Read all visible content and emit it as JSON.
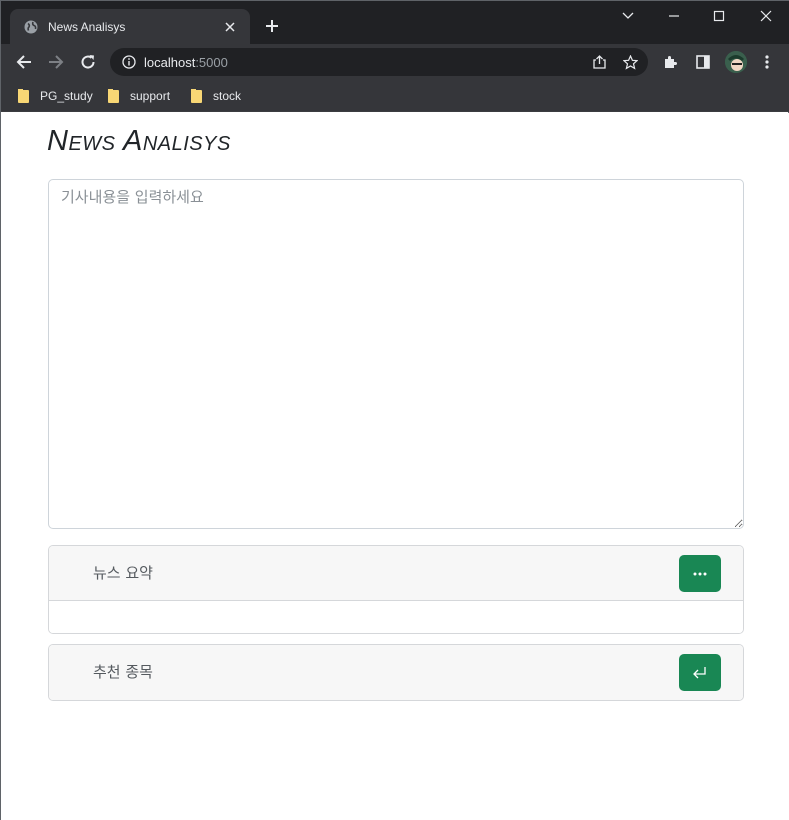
{
  "browser": {
    "tab_title": "News Analisys",
    "url_host": "localhost",
    "url_port": ":5000",
    "bookmarks": [
      {
        "label": "PG_study",
        "icon": "folder-icon"
      },
      {
        "label": "support",
        "icon": "folder-icon"
      },
      {
        "label": "stock",
        "icon": "folder-icon"
      }
    ],
    "colors": {
      "frame": "#202124",
      "toolbar": "#35363a",
      "text": "#e8eaed"
    }
  },
  "page": {
    "title": "News Analisys",
    "article_input": {
      "placeholder": "기사내용을 입력하세요",
      "value": ""
    },
    "summary_card": {
      "label": "뉴스 요약",
      "button_icon": "ellipsis-icon"
    },
    "recommend_card": {
      "label": "추천 종목",
      "button_icon": "enter-return-icon"
    },
    "colors": {
      "button": "#198754",
      "card_header": "#f7f7f7",
      "border": "#ced4da"
    }
  }
}
